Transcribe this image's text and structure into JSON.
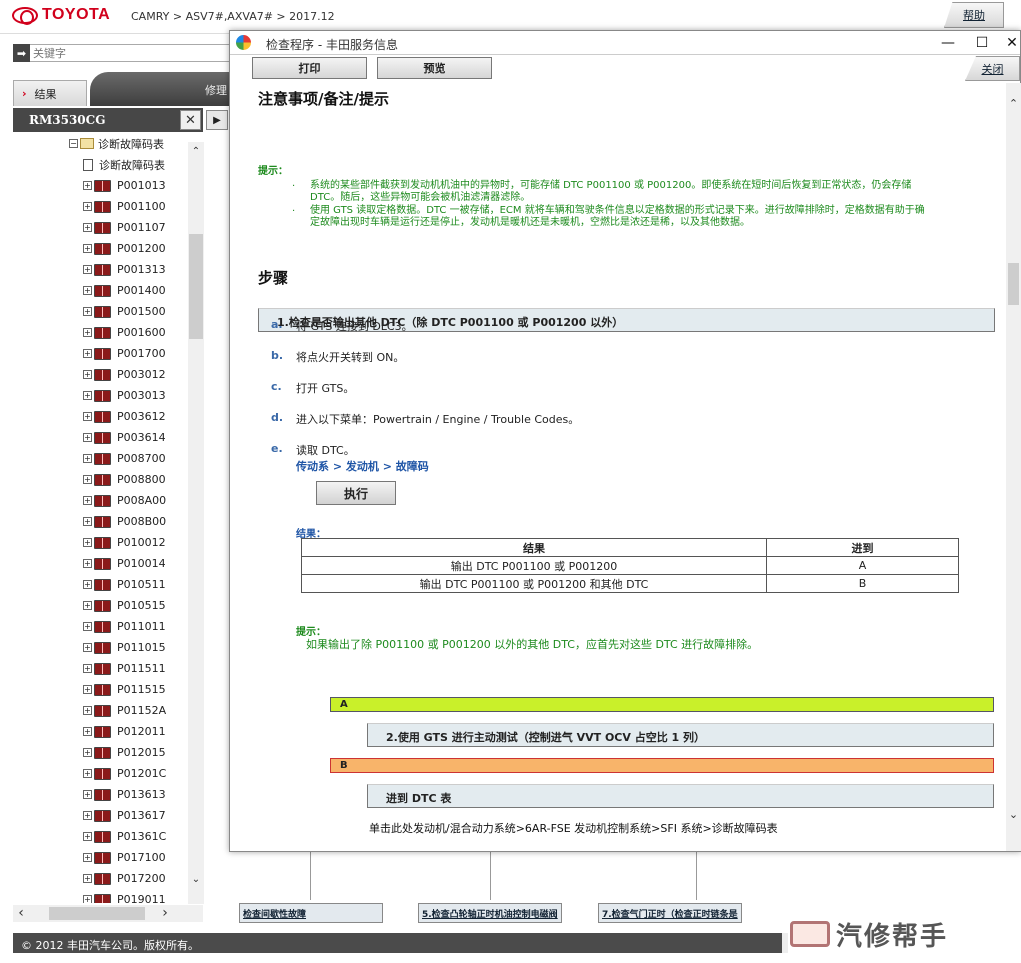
{
  "header": {
    "brand": "TOYOTA",
    "breadcrumb": "CAMRY > ASV7#,AXVA7# > 2017.12",
    "help": "帮助"
  },
  "sidebar": {
    "search_placeholder": "关键字",
    "tab_result": "结果",
    "tab_repair": "修理",
    "doc_id": "RM3530CG",
    "tree_root": "诊断故障码表",
    "tree_doc": "诊断故障码表",
    "codes": [
      "P001013",
      "P001100",
      "P001107",
      "P001200",
      "P001313",
      "P001400",
      "P001500",
      "P001600",
      "P001700",
      "P003012",
      "P003013",
      "P003612",
      "P003614",
      "P008700",
      "P008800",
      "P008A00",
      "P008B00",
      "P010012",
      "P010014",
      "P010511",
      "P010515",
      "P011011",
      "P011015",
      "P011511",
      "P011515",
      "P01152A",
      "P012011",
      "P012015",
      "P01201C",
      "P013613",
      "P013617",
      "P01361C",
      "P017100",
      "P017200",
      "P019011"
    ]
  },
  "background": {
    "boxes": [
      "检查间歇性故障",
      "5.检查凸轮轴正时机油控制电磁阀",
      "7.检查气门正时（检查正时链条是"
    ]
  },
  "footer": {
    "copyright": "© 2012 丰田汽车公司。版权所有。",
    "watermark": "汽修帮手"
  },
  "popup": {
    "title": "检查程序 - 丰田服务信息",
    "print": "打印",
    "preview": "预览",
    "close": "关闭",
    "notes_heading": "注意事项/备注/提示",
    "hint_label": "提示：",
    "hint_1a": "系统的某些部件截获到发动机机油中的异物时，可能存储 DTC P001100 或 P001200。即使系统在短时间后恢复到正常状态，仍会存储",
    "hint_1b": "DTC。随后，这些异物可能会被机油滤清器滤除。",
    "hint_2a": "使用 GTS 读取定格数据。DTC 一被存储，ECM 就将车辆和驾驶条件信息以定格数据的形式记录下来。进行故障排除时，定格数据有助于确",
    "hint_2b": "定故障出现时车辆是运行还是停止，发动机是暖机还是未暖机，空燃比是浓还是稀，以及其他数据。",
    "steps_heading": "步骤",
    "step1": "1.检查是否输出其他 DTC（除 DTC P001100 或 P001200 以外）",
    "substeps": [
      {
        "letter": "a.",
        "text": "将 GTS 连接到 DLC3。"
      },
      {
        "letter": "b.",
        "text": "将点火开关转到 ON。"
      },
      {
        "letter": "c.",
        "text": "打开 GTS。"
      },
      {
        "letter": "d.",
        "text": "进入以下菜单：Powertrain / Engine / Trouble Codes。"
      },
      {
        "letter": "e.",
        "text": "读取 DTC。"
      }
    ],
    "menu_path": "传动系 > 发动机 > 故障码",
    "execute": "执行",
    "result_label": "结果：",
    "table": {
      "headers": [
        "结果",
        "进到"
      ],
      "rows": [
        [
          "输出 DTC P001100 或 P001200",
          "A"
        ],
        [
          "输出 DTC P001100 或 P001200 和其他 DTC",
          "B"
        ]
      ]
    },
    "hint2_label": "提示：",
    "hint2_text": "如果输出了除 P001100 或 P001200 以外的其他 DTC，应首先对这些 DTC 进行故障排除。",
    "branch_a": "A",
    "step2": "2.使用 GTS 进行主动测试（控制进气 VVT OCV 占空比 1 列）",
    "branch_b": "B",
    "goto_dtc": "进到 DTC 表",
    "link_path": "单击此处发动机/混合动力系统>6AR-FSE 发动机控制系统>SFI 系统>诊断故障码表"
  },
  "colors": {
    "brand_red": "#d1001c",
    "hint_green": "#1e8b1e",
    "link_blue": "#1f55a6",
    "branch_a": "#c9f02a",
    "branch_b": "#f8b46a"
  }
}
